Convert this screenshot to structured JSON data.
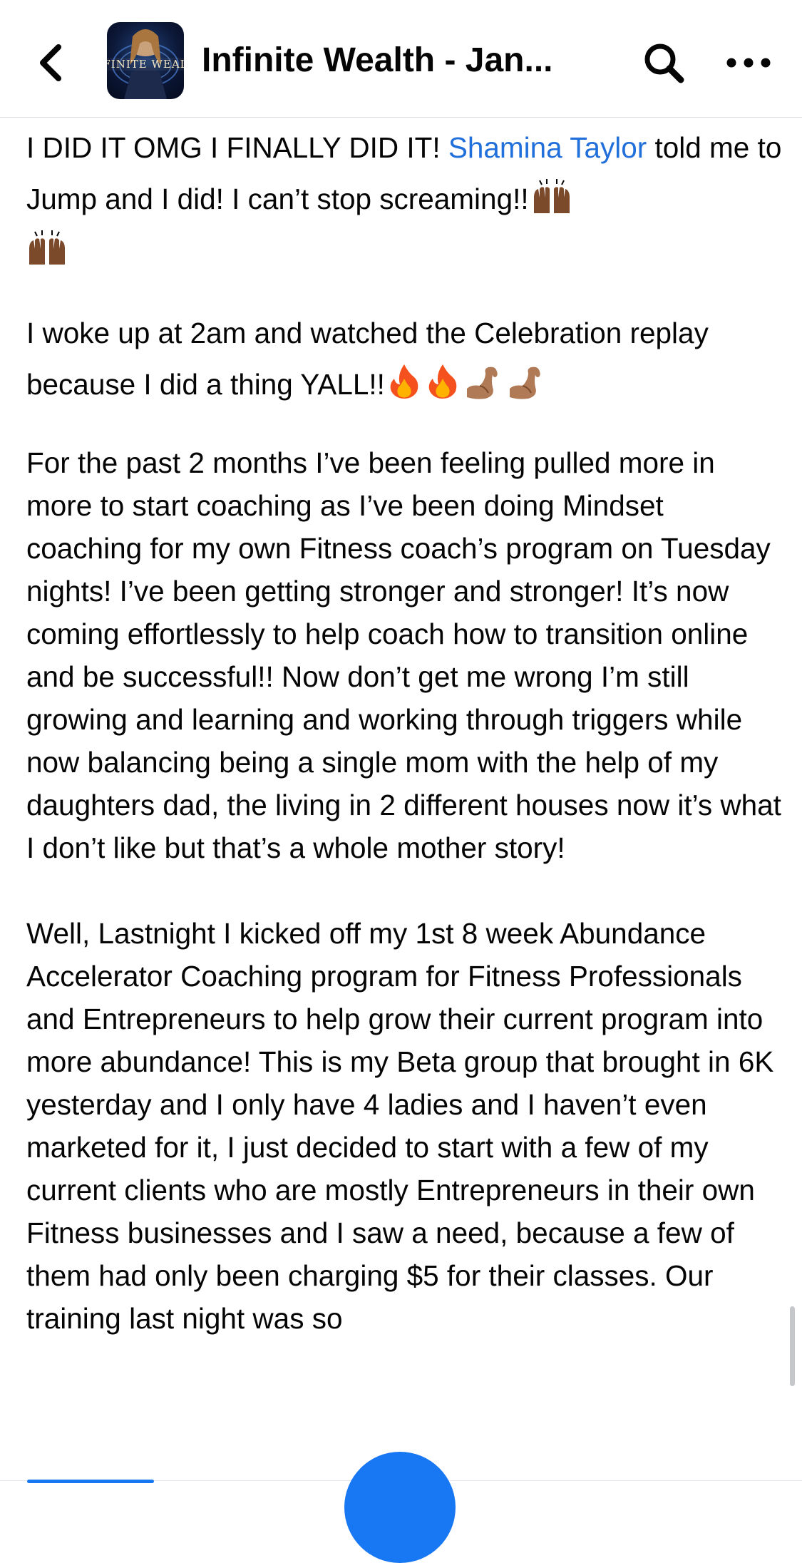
{
  "header": {
    "title": "Infinite Wealth - Jan...",
    "avatar_text": "FINITE WEAL",
    "back_icon": "chevron-left-icon",
    "search_icon": "search-icon",
    "more_icon": "more-horizontal-icon"
  },
  "post": {
    "p1_pre": "I DID IT OMG I FINALLY DID IT! ",
    "p1_mention": "Shamina Taylor",
    "p1_post": " told me to Jump and I did! I can’t stop screaming!!",
    "p2": "I woke up at 2am and watched the Celebration replay because I did a thing YALL!!",
    "p3": "For the past 2 months I’ve been feeling pulled more in more to start coaching as I’ve been doing Mindset coaching for my own Fitness coach’s program on Tuesday nights! I’ve been getting stronger and stronger! It’s now coming effortlessly to help coach how to transition online and be successful!! Now don’t get me wrong I’m still growing and learning and working through triggers while now balancing being a single mom with the help of my daughters dad, the living in 2 different houses now it’s what I don’t like but that’s a whole mother story!",
    "p4": "Well, Lastnight I kicked off my 1st 8 week Abundance Accelerator Coaching program for Fitness Professionals and Entrepreneurs to help grow their current program into more abundance! This is my Beta group that brought in 6K yesterday and I only have 4 ladies and I haven’t even marketed for it, I just decided to start with a few of my current clients who are mostly Entrepreneurs in their own Fitness businesses and I saw a need, because a few of them had only been charging $5 for their classes. Our training last night was so"
  },
  "emojis": [
    "raising-hands-icon",
    "raising-hands-icon",
    "fire-icon",
    "fire-icon",
    "flexed-biceps-icon",
    "flexed-biceps-icon"
  ],
  "colors": {
    "accent": "#1877f2",
    "mention": "#216fdb",
    "text": "#050505",
    "skin_dark": "#7a4a2a",
    "skin_medium": "#b07a56",
    "fire_outer": "#f4511e",
    "fire_inner": "#ffb300"
  }
}
